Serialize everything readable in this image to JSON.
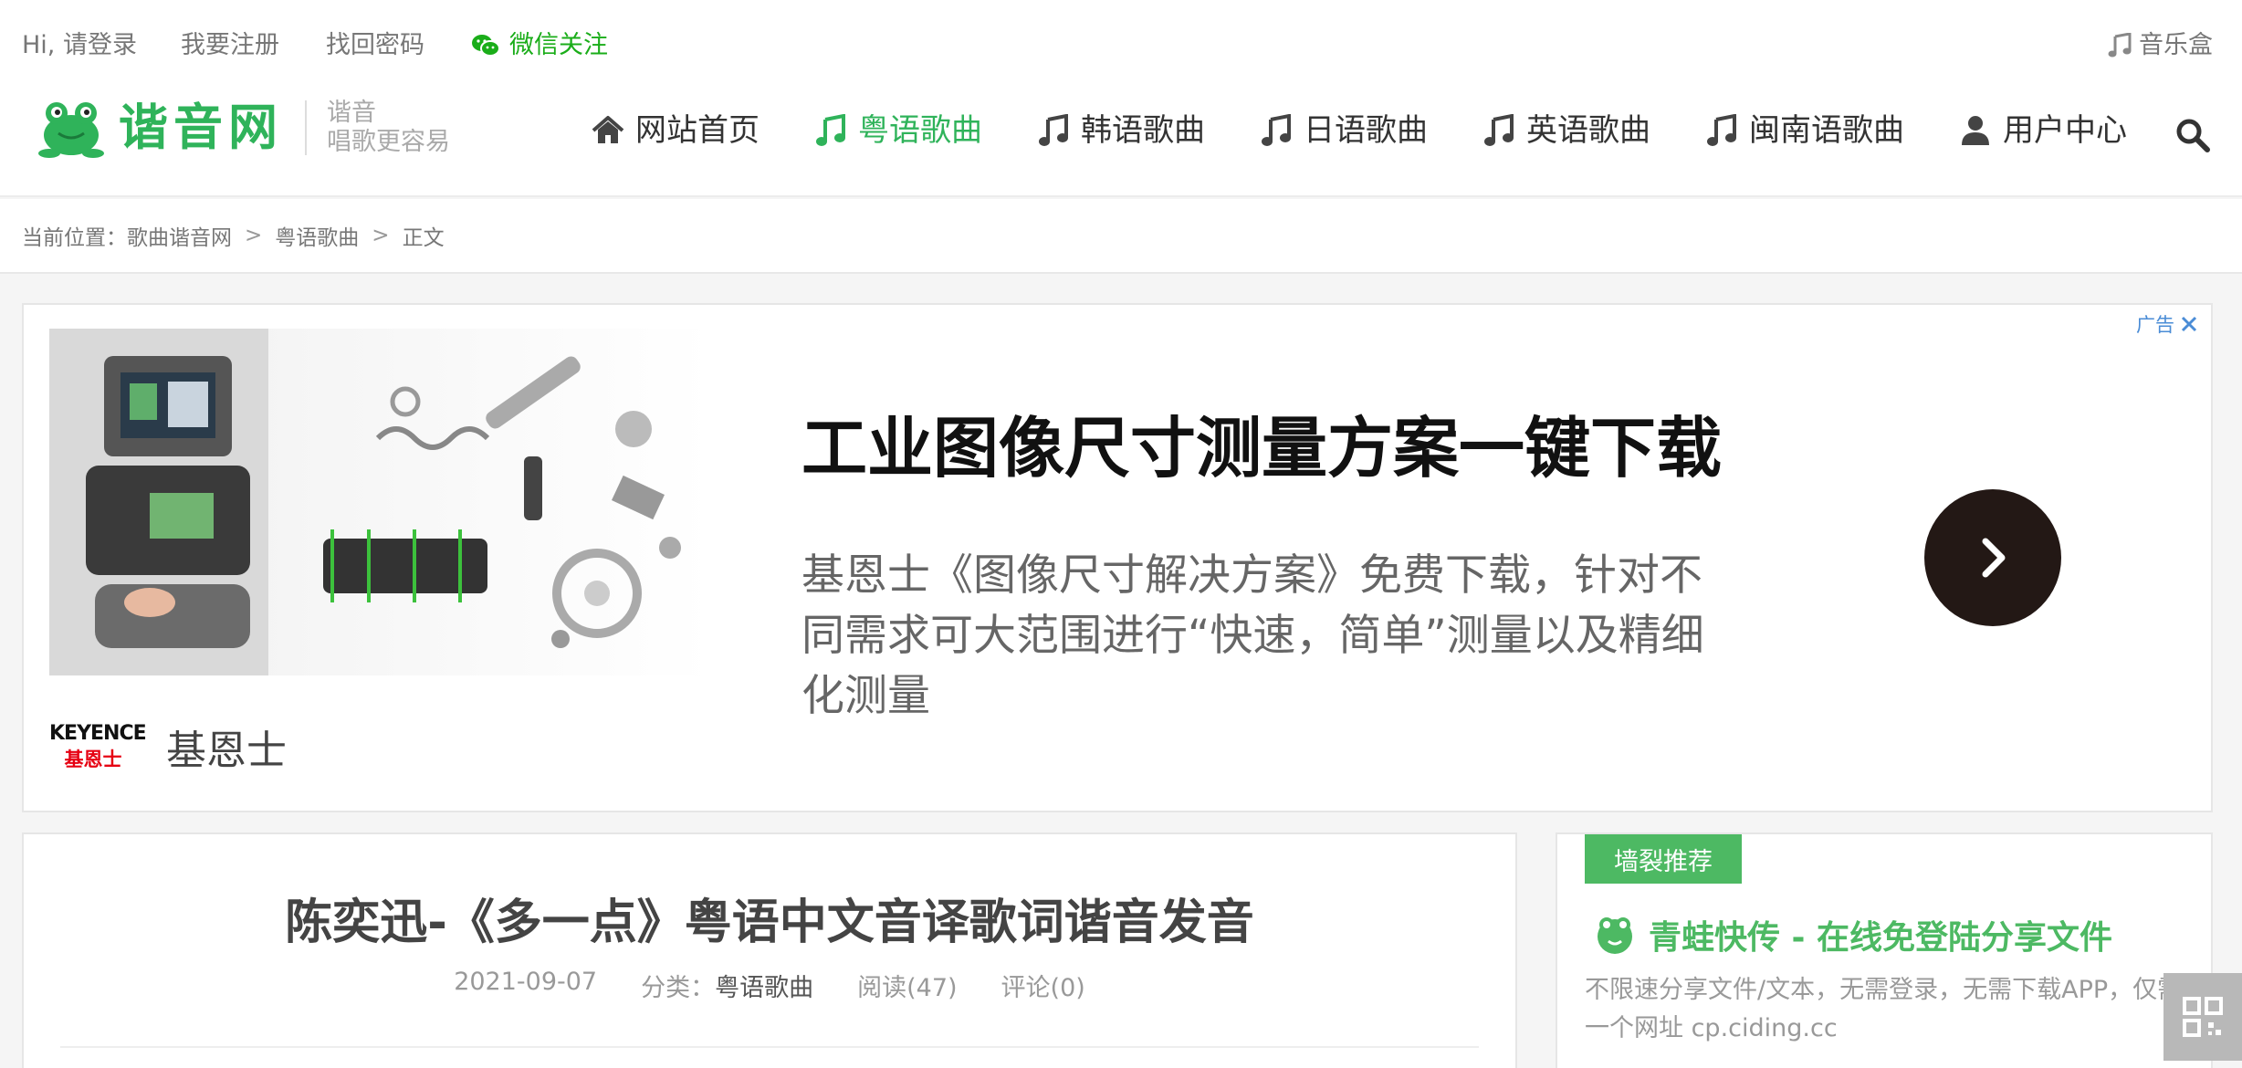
{
  "topbar": {
    "greeting": "Hi, 请登录",
    "register": "我要注册",
    "recover": "找回密码",
    "wechat": "微信关注",
    "music_box": "音乐盒"
  },
  "header": {
    "logo_text": "谐音网",
    "slogan_line1": "谐音",
    "slogan_line2": "唱歌更容易",
    "nav": [
      {
        "label": "网站首页",
        "icon": "home-icon"
      },
      {
        "label": "粤语歌曲",
        "icon": "music-note-icon",
        "active": true
      },
      {
        "label": "韩语歌曲",
        "icon": "music-note-icon"
      },
      {
        "label": "日语歌曲",
        "icon": "music-note-icon"
      },
      {
        "label": "英语歌曲",
        "icon": "music-note-icon"
      },
      {
        "label": "闽南语歌曲",
        "icon": "music-note-icon"
      },
      {
        "label": "用户中心",
        "icon": "user-icon"
      }
    ]
  },
  "breadcrumb": {
    "prefix": "当前位置：",
    "items": [
      "歌曲谐音网",
      "粤语歌曲",
      "正文"
    ],
    "separator": ">"
  },
  "ad": {
    "tag": "广告",
    "title": "工业图像尺寸测量方案一键下载",
    "description": "基恩士《图像尺寸解决方案》免费下载，针对不同需求可大范围进行“快速，简单”测量以及精细化测量",
    "brand_logo_en": "KEYENCE",
    "brand_logo_cn": "基恩士",
    "brand_name": "基恩士"
  },
  "article": {
    "title": "陈奕迅-《多一点》粤语中文音译歌词谐音发音",
    "date": "2021-09-07",
    "category_label": "分类：",
    "category": "粤语歌曲",
    "reads": "阅读(47)",
    "comments": "评论(0)"
  },
  "sidebar": {
    "badge": "墙裂推荐",
    "title": "青蛙快传 - 在线免登陆分享文件",
    "description": "不限速分享文件/文本，无需登录，无需下载APP，仅需一个网址 cp.ciding.cc"
  },
  "colors": {
    "brand_green": "#2fb35a",
    "sidebar_green": "#4db963",
    "wechat_green": "#1aad19",
    "ad_button": "#231815"
  }
}
